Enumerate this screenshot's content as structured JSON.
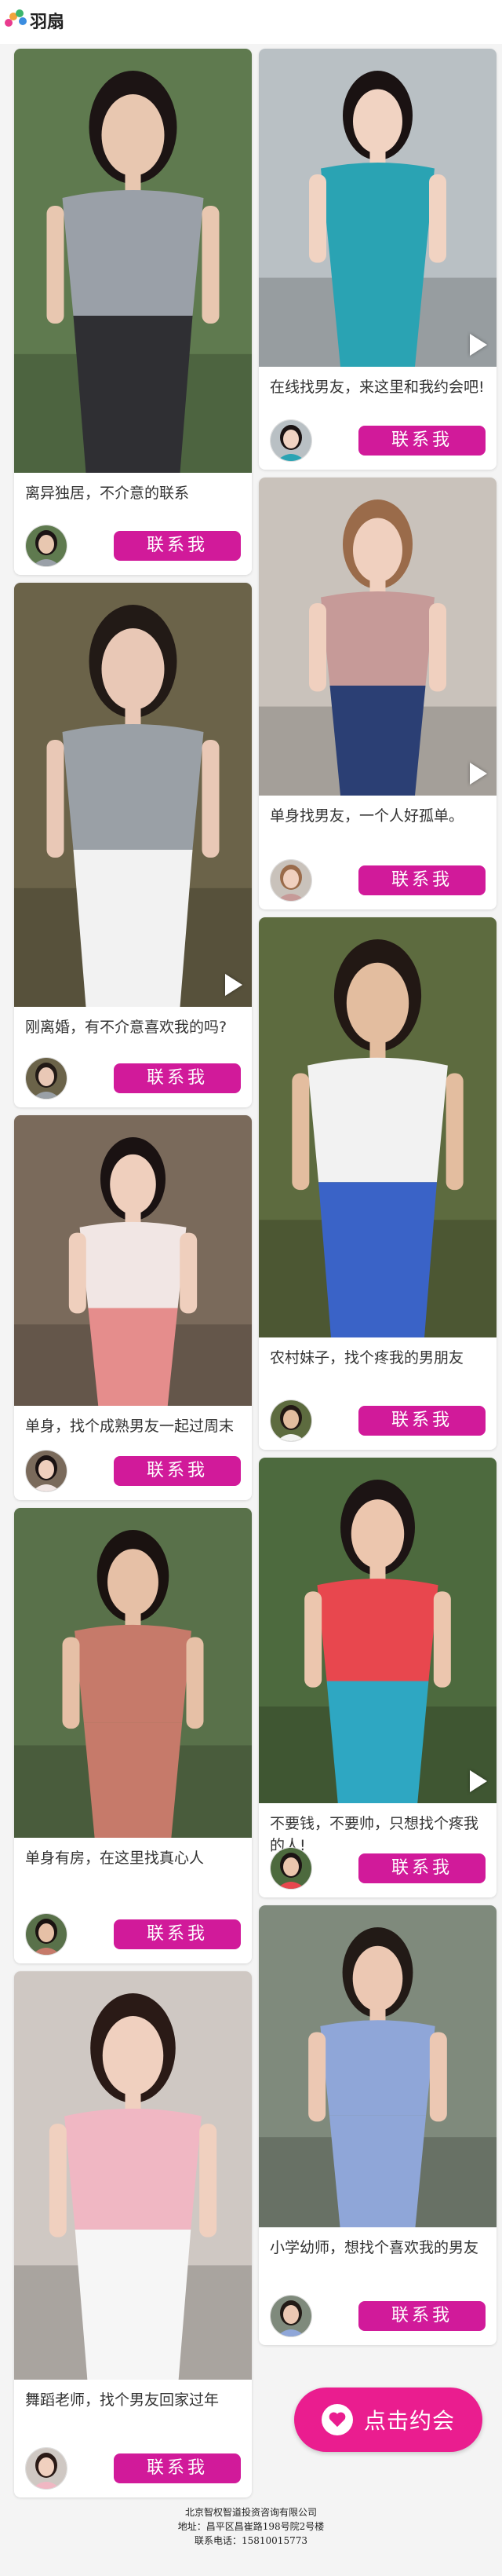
{
  "header": {
    "logo_text": "羽扇"
  },
  "colors": {
    "accent": "#d11a9a",
    "cta": "#ea1d8f"
  },
  "button_label": "联系我",
  "cards": [
    {
      "caption": "离异独居，不介意的联系",
      "skin": "#e8c7b0",
      "bg": "#5f7a4f",
      "top": "#9aa0a8",
      "bottom": "#2f2f33",
      "hair": "#1c1414",
      "video": false
    },
    {
      "caption": "在线找男友，来这里和我约会吧!",
      "skin": "#f1d3c2",
      "bg": "#b9c0c4",
      "top": "#2aa3b3",
      "bottom": "#2aa3b3",
      "hair": "#1a1212",
      "video": true
    },
    {
      "caption": "刚离婚，有不介意喜欢我的吗?",
      "skin": "#e9c8b6",
      "bg": "#6b6349",
      "top": "#9aa0a6",
      "bottom": "#f2f2f2",
      "hair": "#221a16",
      "video": true
    },
    {
      "caption": "单身找男友，一个人好孤单。",
      "skin": "#f0d0bf",
      "bg": "#c9c2bb",
      "top": "#c69a98",
      "bottom": "#2b3f74",
      "hair": "#9a6b4a",
      "video": true
    },
    {
      "caption": "单身，找个成熟男友一起过周末",
      "skin": "#efcfbd",
      "bg": "#7a6a5b",
      "top": "#f1e6e4",
      "bottom": "#e58d8c",
      "hair": "#1a1212",
      "video": false
    },
    {
      "caption": "农村妹子，找个疼我的男朋友",
      "skin": "#e3bd9f",
      "bg": "#5d6b3f",
      "top": "#f2f2f2",
      "bottom": "#3a63c7",
      "hair": "#221814",
      "video": false
    },
    {
      "caption": "单身有房，在这里找真心人",
      "skin": "#e6c0a6",
      "bg": "#59714a",
      "top": "#c67a6a",
      "bottom": "#c67a6a",
      "hair": "#1a1210",
      "video": false
    },
    {
      "caption": "不要钱，不要帅，只想找个疼我的人!",
      "skin": "#ecc6ae",
      "bg": "#4d6a3e",
      "top": "#e8474e",
      "bottom": "#2ea7c2",
      "hair": "#1c1414",
      "video": true
    },
    {
      "caption": "舞蹈老师，找个男友回家过年",
      "skin": "#f0d0bf",
      "bg": "#cfc8c3",
      "top": "#f0b7c3",
      "bottom": "#f6f6f6",
      "hair": "#2a1a16",
      "video": false
    },
    {
      "caption": "小学幼师，想找个喜欢我的男友",
      "skin": "#ecc8b3",
      "bg": "#7f8a7c",
      "top": "#8fa6d8",
      "bottom": "#8fa6d8",
      "hair": "#221a16",
      "video": false
    }
  ],
  "cta": {
    "label": "点击约会"
  },
  "footer": {
    "line1": "北京智权智道投资咨询有限公司",
    "line2": "地址：昌平区昌崔路198号院2号楼",
    "line3": "联系电话：15810015773"
  }
}
